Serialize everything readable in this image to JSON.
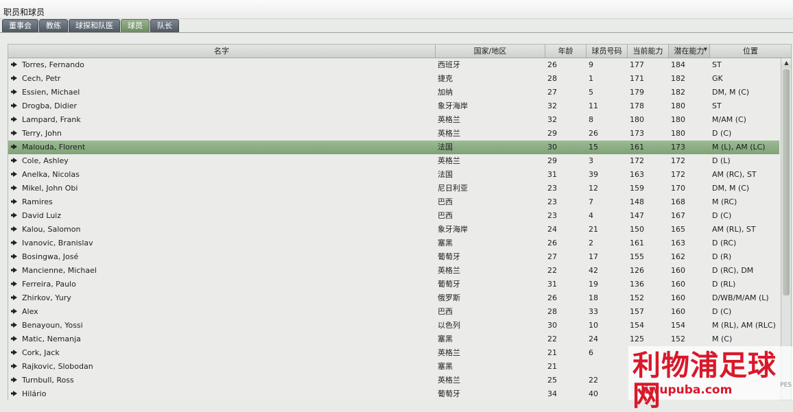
{
  "window": {
    "title": "职员和球员"
  },
  "tabs": [
    {
      "label": "董事会",
      "active": false
    },
    {
      "label": "教练",
      "active": false
    },
    {
      "label": "球探和队医",
      "active": false
    },
    {
      "label": "球员",
      "active": true
    },
    {
      "label": "队长",
      "active": false
    }
  ],
  "table": {
    "columns": {
      "name": "名字",
      "nation": "国家/地区",
      "age": "年龄",
      "number": "球员号码",
      "current_ability": "当前能力",
      "potential_ability": "潜在能力",
      "position": "位置"
    },
    "sorted_column": "potential_ability",
    "sort_direction": "descending",
    "row_icon": "play-arrow-icon",
    "selected_row": 6,
    "rows": [
      {
        "name": "Torres, Fernando",
        "nation": "西班牙",
        "age": "26",
        "number": "9",
        "ca": "177",
        "pa": "184",
        "pos": "ST"
      },
      {
        "name": "Cech, Petr",
        "nation": "捷克",
        "age": "28",
        "number": "1",
        "ca": "171",
        "pa": "182",
        "pos": "GK"
      },
      {
        "name": "Essien, Michael",
        "nation": "加纳",
        "age": "27",
        "number": "5",
        "ca": "179",
        "pa": "182",
        "pos": "DM, M (C)"
      },
      {
        "name": "Drogba, Didier",
        "nation": "象牙海岸",
        "age": "32",
        "number": "11",
        "ca": "178",
        "pa": "180",
        "pos": "ST"
      },
      {
        "name": "Lampard, Frank",
        "nation": "英格兰",
        "age": "32",
        "number": "8",
        "ca": "180",
        "pa": "180",
        "pos": "M/AM (C)"
      },
      {
        "name": "Terry, John",
        "nation": "英格兰",
        "age": "29",
        "number": "26",
        "ca": "173",
        "pa": "180",
        "pos": "D (C)"
      },
      {
        "name": "Malouda, Florent",
        "nation": "法国",
        "age": "30",
        "number": "15",
        "ca": "161",
        "pa": "173",
        "pos": "M (L), AM (LC)"
      },
      {
        "name": "Cole, Ashley",
        "nation": "英格兰",
        "age": "29",
        "number": "3",
        "ca": "172",
        "pa": "172",
        "pos": "D (L)"
      },
      {
        "name": "Anelka, Nicolas",
        "nation": "法国",
        "age": "31",
        "number": "39",
        "ca": "163",
        "pa": "172",
        "pos": "AM (RC), ST"
      },
      {
        "name": "Mikel, John Obi",
        "nation": "尼日利亚",
        "age": "23",
        "number": "12",
        "ca": "159",
        "pa": "170",
        "pos": "DM, M (C)"
      },
      {
        "name": "Ramires",
        "nation": "巴西",
        "age": "23",
        "number": "7",
        "ca": "148",
        "pa": "168",
        "pos": "M (RC)"
      },
      {
        "name": "David Luiz",
        "nation": "巴西",
        "age": "23",
        "number": "4",
        "ca": "147",
        "pa": "167",
        "pos": "D (C)"
      },
      {
        "name": "Kalou, Salomon",
        "nation": "象牙海岸",
        "age": "24",
        "number": "21",
        "ca": "150",
        "pa": "165",
        "pos": "AM (RL), ST"
      },
      {
        "name": "Ivanovic, Branislav",
        "nation": "塞黑",
        "age": "26",
        "number": "2",
        "ca": "161",
        "pa": "163",
        "pos": "D (RC)"
      },
      {
        "name": "Bosingwa, José",
        "nation": "葡萄牙",
        "age": "27",
        "number": "17",
        "ca": "155",
        "pa": "162",
        "pos": "D (R)"
      },
      {
        "name": "Mancienne, Michael",
        "nation": "英格兰",
        "age": "22",
        "number": "42",
        "ca": "126",
        "pa": "160",
        "pos": "D (RC), DM"
      },
      {
        "name": "Ferreira, Paulo",
        "nation": "葡萄牙",
        "age": "31",
        "number": "19",
        "ca": "136",
        "pa": "160",
        "pos": "D (RL)"
      },
      {
        "name": "Zhirkov, Yury",
        "nation": "俄罗斯",
        "age": "26",
        "number": "18",
        "ca": "152",
        "pa": "160",
        "pos": "D/WB/M/AM (L)"
      },
      {
        "name": "Alex",
        "nation": "巴西",
        "age": "28",
        "number": "33",
        "ca": "157",
        "pa": "160",
        "pos": "D (C)"
      },
      {
        "name": "Benayoun, Yossi",
        "nation": "以色列",
        "age": "30",
        "number": "10",
        "ca": "154",
        "pa": "154",
        "pos": "M (RL), AM (RLC)"
      },
      {
        "name": "Matic, Nemanja",
        "nation": "塞黑",
        "age": "22",
        "number": "24",
        "ca": "125",
        "pa": "152",
        "pos": "M (C)"
      },
      {
        "name": "Cork, Jack",
        "nation": "英格兰",
        "age": "21",
        "number": "6",
        "ca": "",
        "pa": "",
        "pos": ""
      },
      {
        "name": "Rajkovic, Slobodan",
        "nation": "塞黑",
        "age": "21",
        "number": "",
        "ca": "",
        "pa": "",
        "pos": ""
      },
      {
        "name": "Turnbull, Ross",
        "nation": "英格兰",
        "age": "25",
        "number": "22",
        "ca": "",
        "pa": "",
        "pos": ""
      },
      {
        "name": "Hilário",
        "nation": "葡萄牙",
        "age": "34",
        "number": "40",
        "ca": "",
        "pa": "",
        "pos": ""
      }
    ]
  },
  "watermark": {
    "main": "利物浦足球网",
    "url": "liwupuba.com",
    "mark": "PES"
  }
}
